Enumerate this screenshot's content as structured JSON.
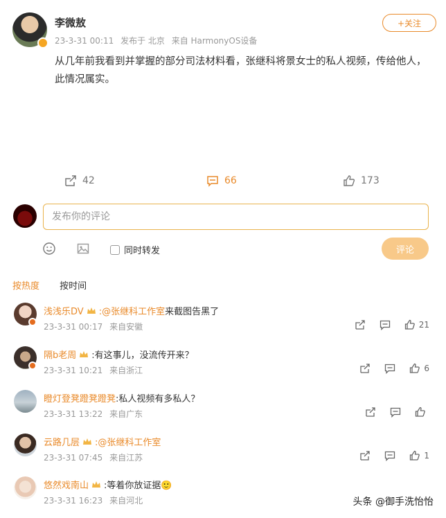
{
  "post": {
    "author": "李微敖",
    "date": "23-3-31 00:11",
    "posted_from": "发布于 北京",
    "device": "来自 HarmonyOS设备",
    "follow_label": "+关注",
    "content": "从几年前我看到并掌握的部分司法材料看，张继科将景女士的私人视频，传给他人，此情况属实。",
    "repost_count": "42",
    "comment_count": "66",
    "like_count": "173"
  },
  "composer": {
    "placeholder": "发布你的评论",
    "repost_label": "同时转发",
    "submit_label": "评论"
  },
  "sort_tabs": {
    "hot": "按热度",
    "time": "按时间"
  },
  "comments": [
    {
      "name": "浅浅乐DV",
      "mention": ":@张继科工作室",
      "text": " 来截图告黑了",
      "date": "23-3-31 00:17",
      "location": "来自安徽",
      "likes": "21"
    },
    {
      "name": "隔b老周",
      "mention": "",
      "text": ":有这事儿，没流传开来？",
      "date": "23-3-31 10:21",
      "location": "来自浙江",
      "likes": "6"
    },
    {
      "name": "瞪灯登凳蹬凳蹬凳",
      "mention": "",
      "text": ":私人视频有多私人？",
      "date": "23-3-31 13:22",
      "location": "来自广东",
      "likes": ""
    },
    {
      "name": "云路几层",
      "mention": ":@张继科工作室",
      "text": "",
      "date": "23-3-31 07:45",
      "location": "来自江苏",
      "likes": "1"
    },
    {
      "name": "悠然戏南山",
      "mention": "",
      "text": ":等着你放证据🙂",
      "date": "23-3-31 16:23",
      "location": "来自河北",
      "likes": ""
    }
  ],
  "watermark": "头条 @御手洗怡怡",
  "colors": {
    "accent": "#e98a2a",
    "muted": "#999999"
  }
}
